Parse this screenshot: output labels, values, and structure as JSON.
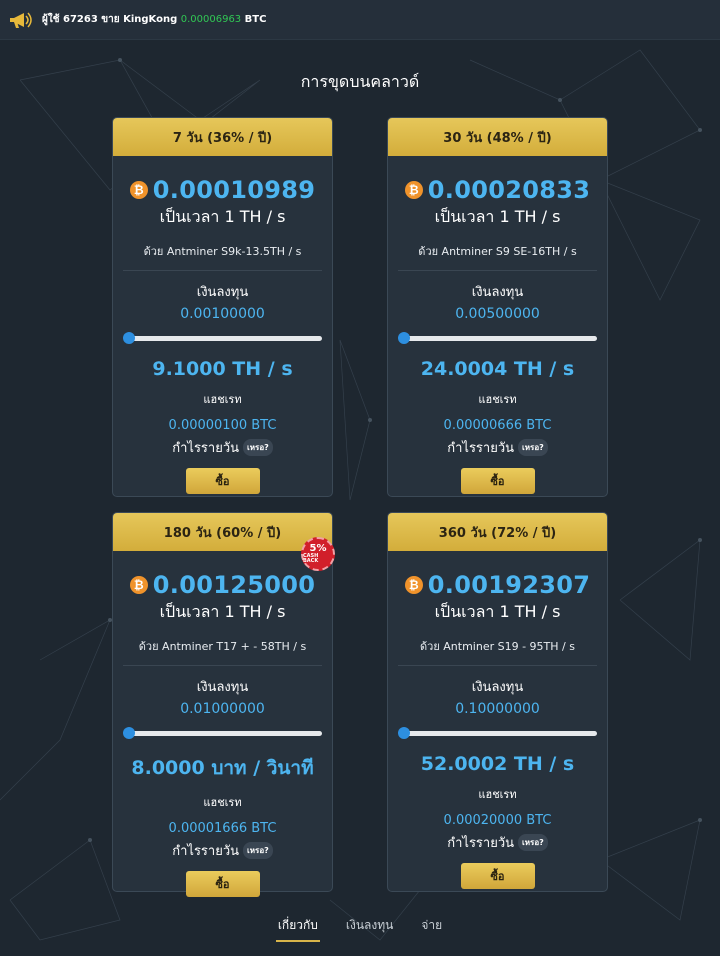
{
  "ticker": {
    "prefix": "ผู้ใช้ 67263 ขาย KingKong",
    "amount": "0.00006963",
    "unit": "BTC",
    "icon": "megaphone-icon"
  },
  "page_title": "การขุดบนคลาวด์",
  "labels": {
    "per_unit": "เป็นเวลา 1 TH / s",
    "investment": "เงินลงทุน",
    "hashrate": "แฮชเรท",
    "daily_profit": "กำไรรายวัน",
    "why": "เหรอ?",
    "buy": "ซื้อ",
    "btc_symbol": "₿"
  },
  "cashback_badge": {
    "percent": "5%",
    "text": "CASH BACK"
  },
  "plans": [
    {
      "header": "7 วัน (36% / ปี)",
      "rate": "0.00010989",
      "machine": "ด้วย Antminer S9k-13.5TH / s",
      "investment": "0.00100000",
      "slider_fraction": 0.0,
      "hashrate": "9.1000 TH / s",
      "daily_profit": "0.00000100 BTC"
    },
    {
      "header": "30 วัน (48% / ปี)",
      "rate": "0.00020833",
      "machine": "ด้วย Antminer S9 SE-16TH / s",
      "investment": "0.00500000",
      "slider_fraction": 0.0,
      "hashrate": "24.0004 TH / s",
      "daily_profit": "0.00000666 BTC"
    },
    {
      "header": "180 วัน (60% / ปี)",
      "rate": "0.00125000",
      "machine": "ด้วย Antminer T17 + - 58TH / s",
      "investment": "0.01000000",
      "slider_fraction": 0.0,
      "hashrate": "8.0000 บาท / วินาที",
      "daily_profit": "0.00001666 BTC"
    },
    {
      "header": "360 วัน (72% / ปี)",
      "rate": "0.00192307",
      "machine": "ด้วย Antminer S19 - 95TH / s",
      "investment": "0.10000000",
      "slider_fraction": 0.0,
      "hashrate": "52.0002 TH / s",
      "daily_profit": "0.00020000 BTC"
    }
  ],
  "tabs": [
    {
      "label": "เกี่ยวกับ",
      "active": true
    },
    {
      "label": "เงินลงทุน",
      "active": false
    },
    {
      "label": "จ่าย",
      "active": false
    }
  ],
  "colors": {
    "background": "#1e2730",
    "card": "#27323d",
    "gold": "#d9b548",
    "accent_blue": "#4db5f0",
    "slider_blue": "#2d8fe0",
    "ticker_green": "#31c754",
    "cashback_red": "#d11f2a"
  }
}
